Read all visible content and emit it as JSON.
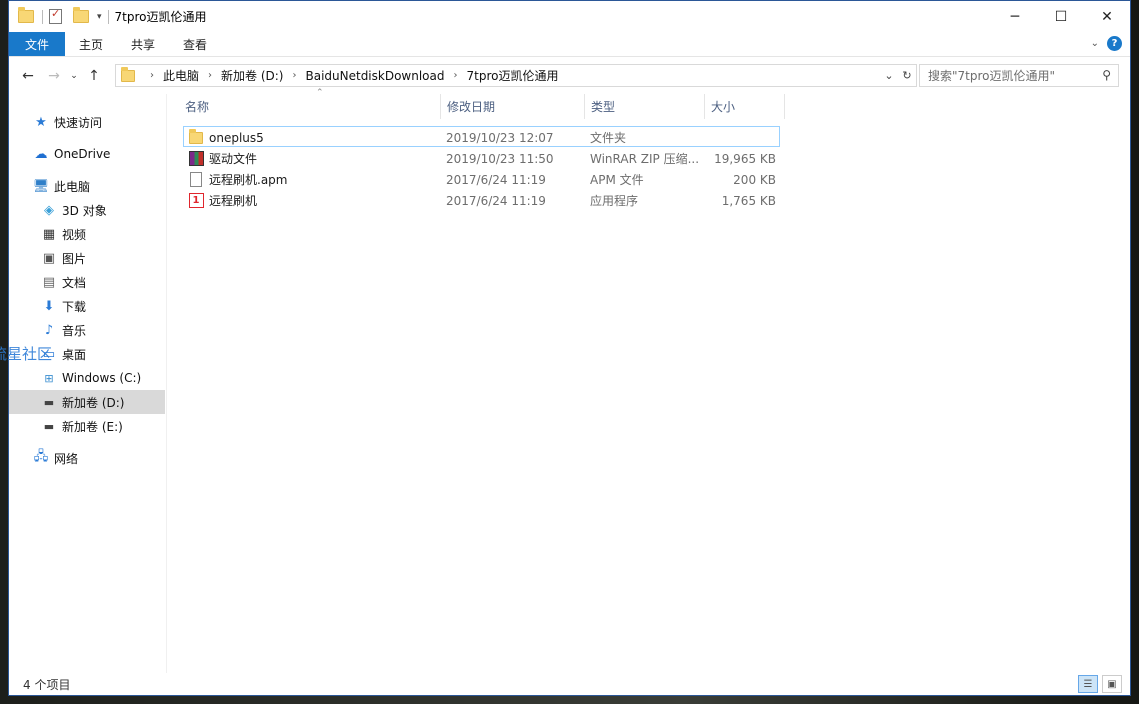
{
  "window": {
    "title": "7tpro迈凯伦通用"
  },
  "window_buttons": {
    "minimize": "─",
    "maximize": "☐",
    "close": "✕"
  },
  "ribbon": {
    "tabs": [
      "文件",
      "主页",
      "共享",
      "查看"
    ],
    "help": "?"
  },
  "nav": {
    "back": "←",
    "forward": "→",
    "dropdown": "⌄",
    "up": "↑"
  },
  "address": {
    "crumbs": [
      "此电脑",
      "新加卷 (D:)",
      "BaiduNetdiskDownload",
      "7tpro迈凯伦通用"
    ],
    "refresh": "↻",
    "dropdown": "⌄"
  },
  "search": {
    "placeholder": "搜索\"7tpro迈凯伦通用\""
  },
  "sidebar": {
    "items": [
      {
        "label": "快速访问",
        "icon": "star-icon"
      },
      {
        "label": "OneDrive",
        "icon": "cloud-icon"
      },
      {
        "label": "此电脑",
        "icon": "computer-icon"
      },
      {
        "label": "3D 对象",
        "icon": "cube-icon"
      },
      {
        "label": "视频",
        "icon": "video-icon"
      },
      {
        "label": "图片",
        "icon": "picture-icon"
      },
      {
        "label": "文档",
        "icon": "document-icon"
      },
      {
        "label": "下载",
        "icon": "download-icon"
      },
      {
        "label": "音乐",
        "icon": "music-icon"
      },
      {
        "label": "桌面",
        "icon": "desktop-icon"
      },
      {
        "label": "Windows (C:)",
        "icon": "drive-windows-icon"
      },
      {
        "label": "新加卷 (D:)",
        "icon": "drive-icon"
      },
      {
        "label": "新加卷 (E:)",
        "icon": "drive-icon"
      },
      {
        "label": "网络",
        "icon": "network-icon"
      }
    ]
  },
  "table": {
    "headers": [
      "名称",
      "修改日期",
      "类型",
      "大小"
    ],
    "rows": [
      {
        "name": "oneplus5",
        "date": "2019/10/23 12:07",
        "type": "文件夹",
        "size": "",
        "icon": "folder-icon"
      },
      {
        "name": "驱动文件",
        "date": "2019/10/23 11:50",
        "type": "WinRAR ZIP 压缩...",
        "size": "19,965 KB",
        "icon": "winrar-icon"
      },
      {
        "name": "远程刷机.apm",
        "date": "2017/6/24 11:19",
        "type": "APM 文件",
        "size": "200 KB",
        "icon": "file-icon"
      },
      {
        "name": "远程刷机",
        "date": "2017/6/24 11:19",
        "type": "应用程序",
        "size": "1,765 KB",
        "icon": "oneplus-app-icon"
      }
    ]
  },
  "status": {
    "count": "4 个项目"
  },
  "watermark": "流星社区"
}
